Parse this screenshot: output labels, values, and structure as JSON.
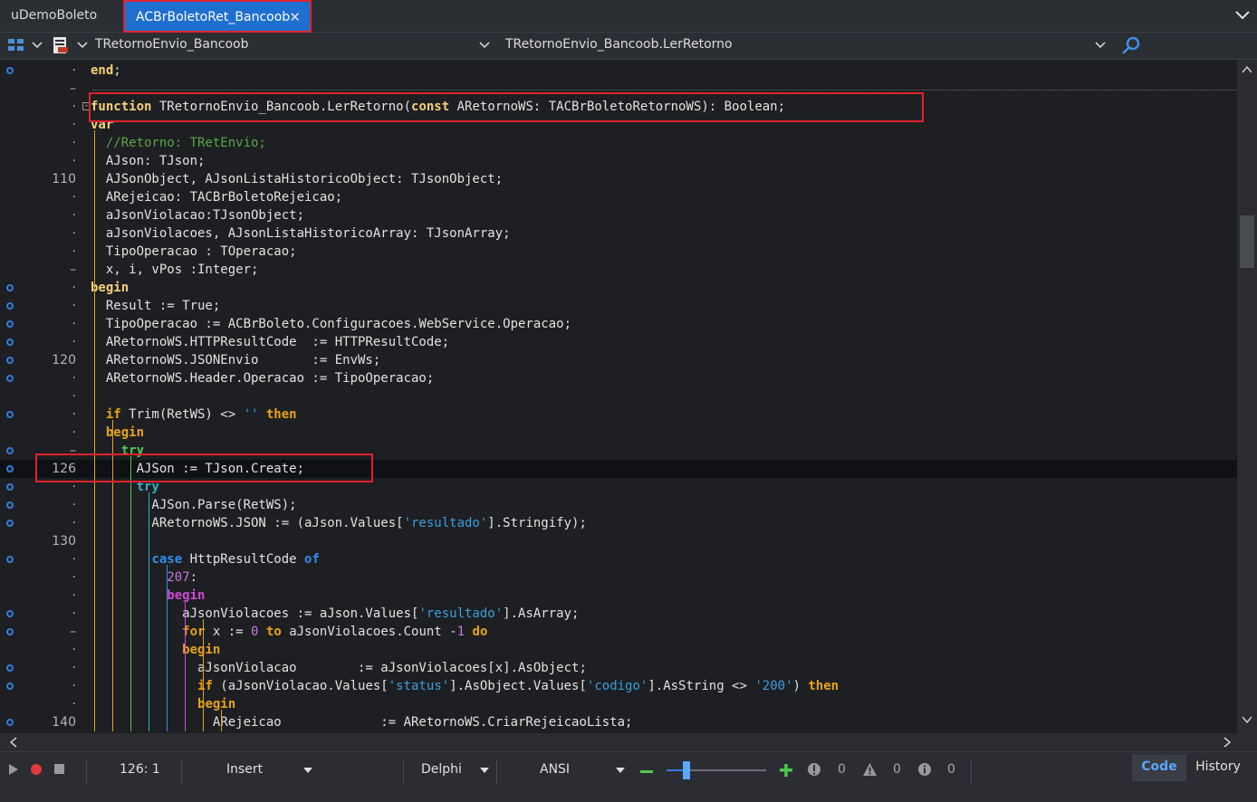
{
  "tabs": [
    {
      "label": "uDemoBoleto"
    },
    {
      "label": "ACBrBoletoRet_Bancoob"
    }
  ],
  "navbar": {
    "class_combo": "TRetornoEnvio_Bancoob",
    "method_combo": "TRetornoEnvio_Bancoob.LerRetorno"
  },
  "code_lines": [
    {
      "num": "·",
      "bp": true,
      "html": "<span class='kw'>end</span>;"
    },
    {
      "num": "–",
      "bp": false,
      "html": ""
    },
    {
      "num": "·",
      "bp": false,
      "html": "<span class='kw'>function</span> TRetornoEnvio_Bancoob.LerRetorno(<span class='kw'>const</span> ARetornoWS: TACBrBoletoRetornoWS): Boolean;"
    },
    {
      "num": "·",
      "bp": false,
      "html": "<span class='kw'>var</span>"
    },
    {
      "num": "·",
      "bp": false,
      "html": "  <span class='cmt'>//Retorno: TRetEnvio;</span>"
    },
    {
      "num": "·",
      "bp": false,
      "html": "  AJson: TJson;"
    },
    {
      "num": "110",
      "bp": false,
      "html": "  AJSonObject, AJsonListaHistoricoObject: TJsonObject;"
    },
    {
      "num": "·",
      "bp": false,
      "html": "  ARejeicao: TACBrBoletoRejeicao;"
    },
    {
      "num": "·",
      "bp": false,
      "html": "  aJsonViolacao:TJsonObject;"
    },
    {
      "num": "·",
      "bp": false,
      "html": "  aJsonViolacoes, AJsonListaHistoricoArray: TJsonArray;"
    },
    {
      "num": "·",
      "bp": false,
      "html": "  TipoOperacao : TOperacao;"
    },
    {
      "num": "–",
      "bp": false,
      "html": "  x, i, vPos :Integer;"
    },
    {
      "num": "·",
      "bp": true,
      "html": "<span class='kw'>begin</span>"
    },
    {
      "num": "·",
      "bp": true,
      "html": "  Result := True;"
    },
    {
      "num": "·",
      "bp": true,
      "html": "  TipoOperacao := ACBrBoleto.Configuracoes.WebService.Operacao;"
    },
    {
      "num": "·",
      "bp": true,
      "html": "  ARetornoWS.HTTPResultCode  := HTTPResultCode;"
    },
    {
      "num": "120",
      "bp": true,
      "html": "  ARetornoWS.JSONEnvio       := EnvWs;"
    },
    {
      "num": "·",
      "bp": true,
      "html": "  ARetornoWS.Header.Operacao := TipoOperacao;"
    },
    {
      "num": "·",
      "bp": false,
      "html": ""
    },
    {
      "num": "·",
      "bp": true,
      "html": "  <span class='kw2'>if</span> Trim(RetWS) &lt;&gt; <span class='str'>''</span> <span class='kw2'>then</span>"
    },
    {
      "num": "·",
      "bp": false,
      "html": "  <span class='kw2'>begin</span>"
    },
    {
      "num": "–",
      "bp": true,
      "html": "    <span class='kwg'>try</span>"
    },
    {
      "num": "126",
      "bp": true,
      "html": "      AJSon := TJson.Create;",
      "current": true
    },
    {
      "num": "·",
      "bp": true,
      "html": "      <span class='kwc'>try</span>"
    },
    {
      "num": "·",
      "bp": true,
      "html": "        AJSon.Parse(RetWS);"
    },
    {
      "num": "·",
      "bp": true,
      "html": "        ARetornoWS.JSON := (aJson.Values[<span class='str'>'resultado'</span>].Stringify);"
    },
    {
      "num": "130",
      "bp": false,
      "html": ""
    },
    {
      "num": "·",
      "bp": true,
      "html": "        <span class='kwb'>case</span> HttpResultCode <span class='kwb'>of</span>"
    },
    {
      "num": "·",
      "bp": false,
      "html": "          <span class='num'>207</span>:"
    },
    {
      "num": "·",
      "bp": false,
      "html": "          <span class='kwm'>begin</span>"
    },
    {
      "num": "·",
      "bp": true,
      "html": "            aJsonViolacoes := aJson.Values[<span class='str'>'resultado'</span>].AsArray;"
    },
    {
      "num": "–",
      "bp": true,
      "html": "            <span class='kw2'>for</span> x := <span class='num'>0</span> <span class='kw2'>to</span> aJsonViolacoes.Count -<span class='num'>1</span> <span class='kw2'>do</span>"
    },
    {
      "num": "·",
      "bp": false,
      "html": "            <span class='kw2'>begin</span>"
    },
    {
      "num": "·",
      "bp": true,
      "html": "              aJsonViolacao        := aJsonViolacoes[x].AsObject;"
    },
    {
      "num": "·",
      "bp": true,
      "html": "              <span class='kw2'>if</span> (aJsonViolacao.Values[<span class='str'>'status'</span>].AsObject.Values[<span class='str'>'codigo'</span>].AsString &lt;&gt; <span class='str'>'200'</span>) <span class='kw2'>then</span>"
    },
    {
      "num": "·",
      "bp": false,
      "html": "              <span class='kw2'>begin</span>"
    },
    {
      "num": "140",
      "bp": true,
      "html": "                ARejeicao             := ARetornoWS.CriarRejeicaoLista;"
    }
  ],
  "status": {
    "position": "126:  1",
    "insert_mode": "Insert",
    "language": "Delphi",
    "encoding": "ANSI",
    "errors": "0",
    "warnings": "0",
    "hints": "0",
    "zoom_fraction": 0.2,
    "code_tab": "Code",
    "history_tab": "History"
  },
  "colors": {
    "accent": "#1e6fd0",
    "highlight_box": "#e0232c",
    "keyword": "#f5d07a",
    "comment": "#57a64a",
    "string": "#3a9fe0"
  }
}
